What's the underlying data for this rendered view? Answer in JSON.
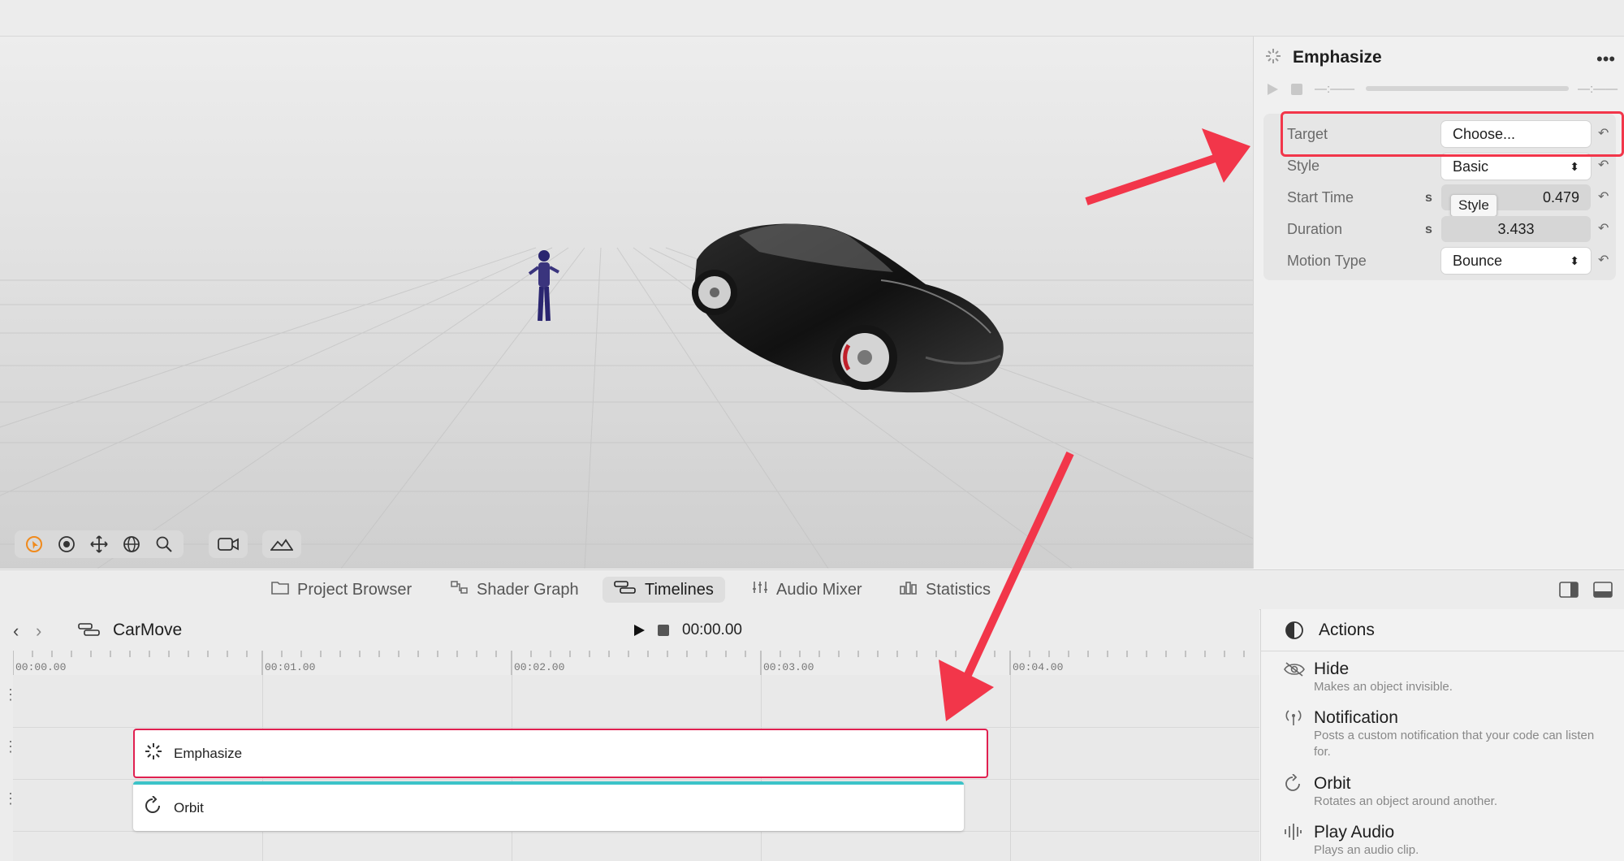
{
  "inspector": {
    "title": "Emphasize",
    "time_left": "—:——",
    "time_right": "—:——",
    "properties": [
      {
        "label": "Target",
        "value": "Choose..."
      },
      {
        "label": "Style",
        "value": "Basic"
      },
      {
        "label": "Start Time",
        "unit": "s",
        "value": "0.479"
      },
      {
        "label": "Duration",
        "unit": "s",
        "value": "3.433"
      },
      {
        "label": "Motion Type",
        "value": "Bounce"
      }
    ],
    "tooltip": "Style"
  },
  "tabs": [
    {
      "label": "Project Browser"
    },
    {
      "label": "Shader Graph"
    },
    {
      "label": "Timelines"
    },
    {
      "label": "Audio Mixer"
    },
    {
      "label": "Statistics"
    }
  ],
  "timeline": {
    "name": "CarMove",
    "time": "00:00.00",
    "ruler": [
      "00:00.00",
      "00:01.00",
      "00:02.00",
      "00:03.00",
      "00:04.00"
    ],
    "clips": [
      {
        "label": "Emphasize"
      },
      {
        "label": "Orbit"
      }
    ]
  },
  "actions": {
    "title": "Actions",
    "items": [
      {
        "name": "Hide",
        "desc": "Makes an object invisible."
      },
      {
        "name": "Notification",
        "desc": "Posts a custom notification that your code can listen for."
      },
      {
        "name": "Orbit",
        "desc": "Rotates an object around another."
      },
      {
        "name": "Play Audio",
        "desc": "Plays an audio clip."
      }
    ]
  },
  "colors": {
    "accent_red": "#f2364a",
    "clip_teal": "#3cc3c8",
    "selection_red": "#e02050"
  }
}
